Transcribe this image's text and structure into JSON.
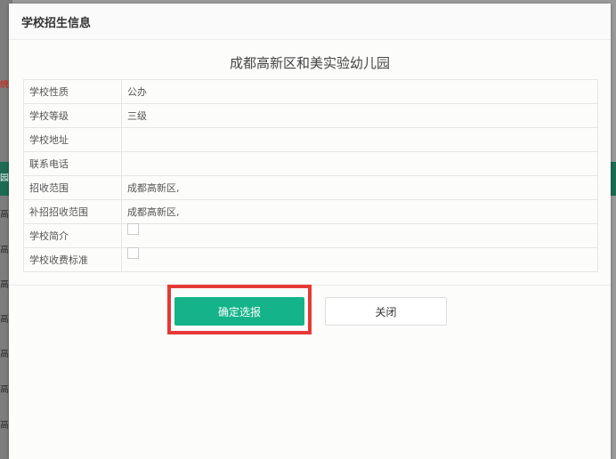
{
  "background": {
    "words": [
      "统",
      "园",
      "高",
      "高",
      "高",
      "高",
      "高",
      "高",
      "高"
    ]
  },
  "modal": {
    "title": "学校招生信息",
    "school_name": "成都高新区和美实验幼儿园",
    "rows": [
      {
        "label": "学校性质",
        "value": "公办"
      },
      {
        "label": "学校等级",
        "value": "三级"
      },
      {
        "label": "学校地址",
        "value": ""
      },
      {
        "label": "联系电话",
        "value": ""
      },
      {
        "label": "招收范围",
        "value": "成都高新区,"
      },
      {
        "label": "补招招收范围",
        "value": "成都高新区,"
      },
      {
        "label": "学校简介",
        "value": ""
      },
      {
        "label": "学校收费标准",
        "value": ""
      }
    ],
    "confirm_label": "确定选报",
    "close_label": "关闭"
  },
  "colors": {
    "confirm": "#15b38a",
    "highlight": "#e53935"
  }
}
